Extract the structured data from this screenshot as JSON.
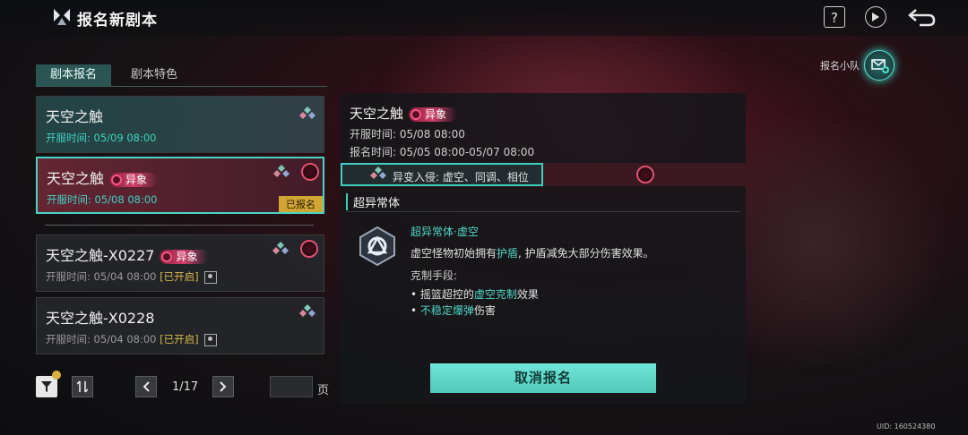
{
  "header": {
    "title": "报名新剧本",
    "help_label": "?"
  },
  "team": {
    "label": "报名小队"
  },
  "tabs": [
    {
      "label": "剧本报名"
    },
    {
      "label": "剧本特色"
    }
  ],
  "scripts": [
    {
      "name": "天空之触",
      "time": "开服时间: 05/09 08:00"
    },
    {
      "name": "天空之触",
      "tag": "异象",
      "time": "开服时间: 05/08 08:00",
      "badge": "已报名"
    },
    {
      "name": "天空之触-X0227",
      "tag": "异象",
      "time": "开服时间: 05/04 08:00",
      "status": "[已开启]"
    },
    {
      "name": "天空之触-X0228",
      "time": "开服时间: 05/04 08:00",
      "status": "[已开启]"
    }
  ],
  "pagination": {
    "current": "1/17",
    "unit": "页"
  },
  "detail": {
    "name": "天空之触",
    "tag": "异象",
    "open_time": "开服时间: 05/08 08:00",
    "reg_time": "报名时间: 05/05 08:00-05/07 08:00",
    "mutation": "异变入侵: 虚空、同调、相位",
    "section_title": "超异常体",
    "entity_title": "超异常体·虚空",
    "desc_a": "虚空怪物初始拥有",
    "desc_hl": "护盾",
    "desc_b": ", 护盾减免大部分伤害效果。",
    "counter_title": "克制手段:",
    "counter1_a": "• 摇篮超控的",
    "counter1_hl": "虚空克制",
    "counter1_b": "效果",
    "counter2_hl": "不稳定爆弹",
    "counter2_b": "伤害",
    "cancel_label": "取消报名"
  },
  "uid": "UID: 160524380"
}
